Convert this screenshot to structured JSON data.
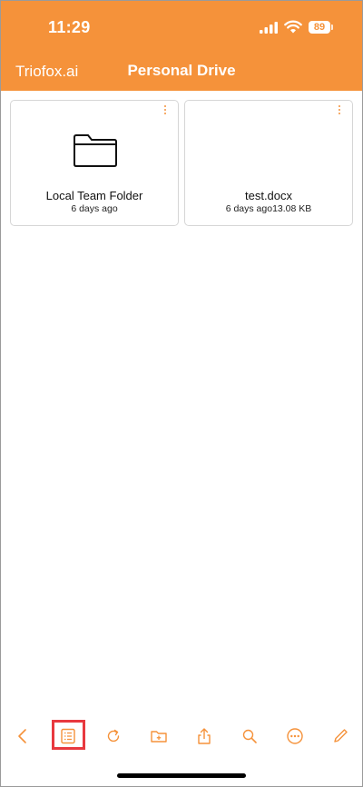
{
  "status_bar": {
    "time": "11:29",
    "battery": "89"
  },
  "nav": {
    "back_label": "Triofox.ai",
    "title": "Personal Drive"
  },
  "items": [
    {
      "name": "Local Team Folder",
      "meta": "6 days ago",
      "icon": "folder-icon"
    },
    {
      "name": "test.docx",
      "meta": "6 days ago13.08 KB",
      "icon": "document-icon"
    }
  ],
  "toolbar": {
    "icons": [
      "back-icon",
      "list-view-icon",
      "refresh-icon",
      "new-folder-icon",
      "upload-icon",
      "search-icon",
      "more-icon",
      "edit-icon"
    ],
    "highlighted": "list-view-icon"
  },
  "colors": {
    "accent": "#F5923A",
    "highlight": "#E8393F"
  }
}
